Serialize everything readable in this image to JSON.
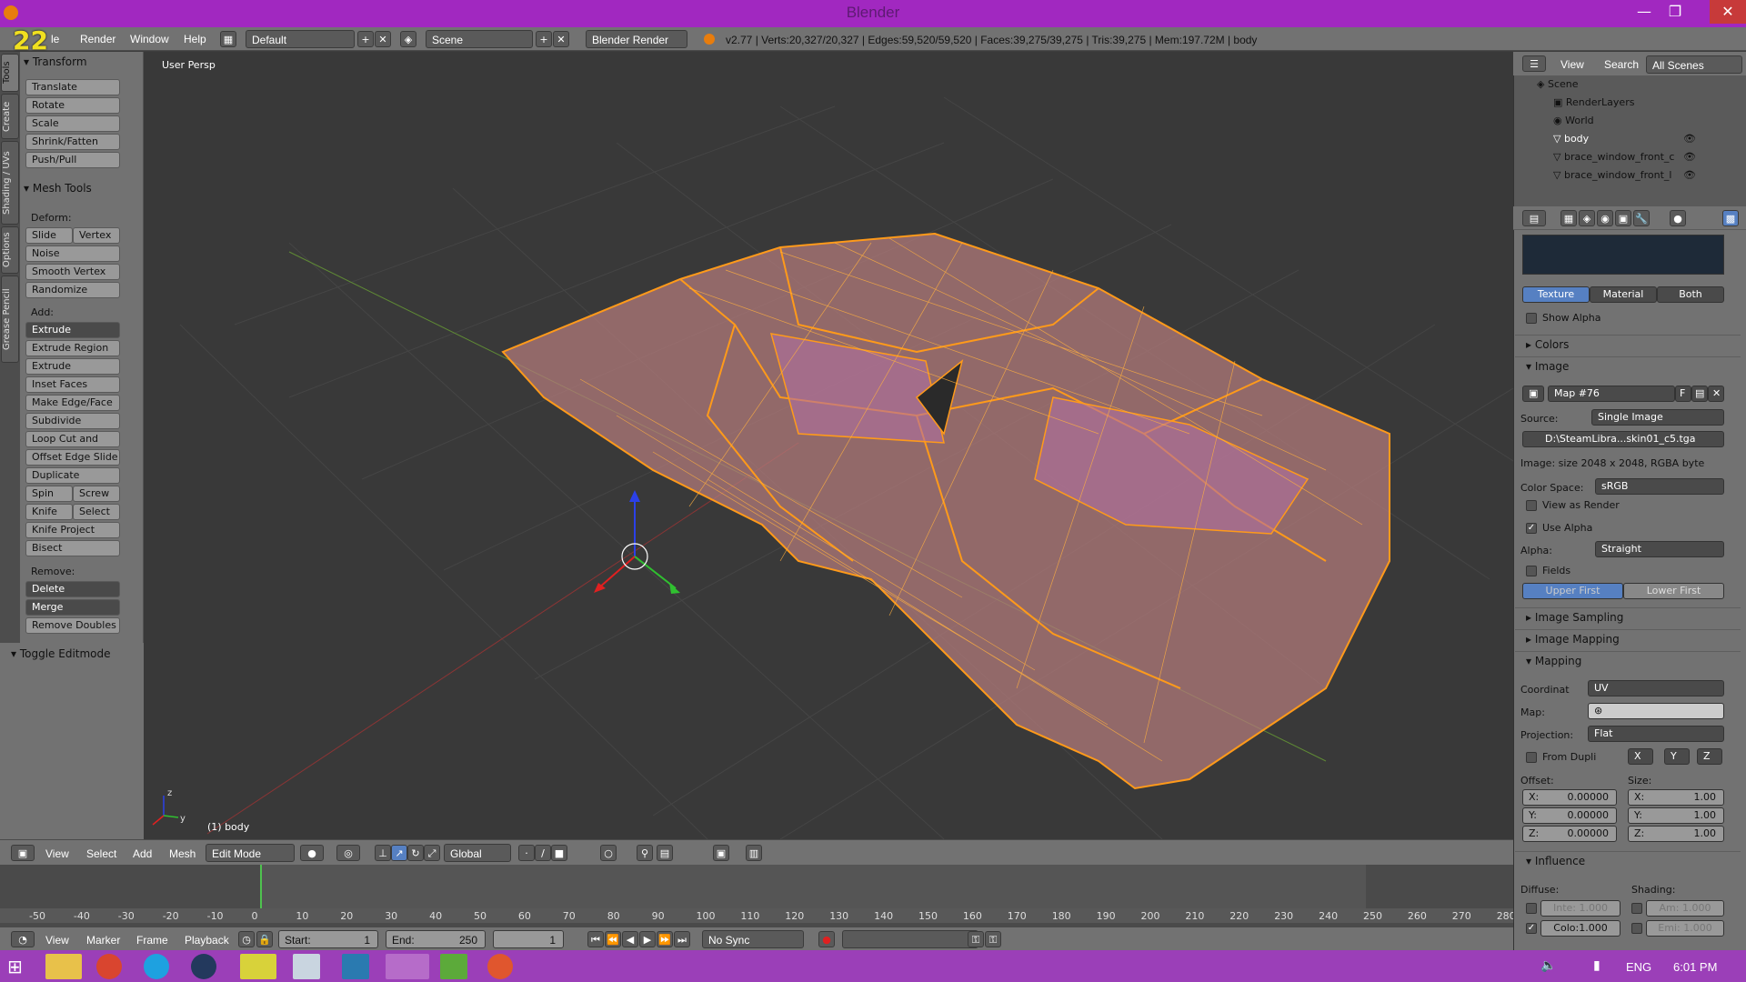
{
  "window": {
    "title": "Blender",
    "minimize": "—",
    "restore": "❐",
    "close": "✕"
  },
  "app_badge": "22",
  "info_header": {
    "menus": [
      "le",
      "Render",
      "Window",
      "Help"
    ],
    "layout": "Default",
    "scene": "Scene",
    "engine": "Blender Render",
    "stats": "v2.77 | Verts:20,327/20,327 | Edges:59,520/59,520 | Faces:39,275/39,275 | Tris:39,275 | Mem:197.72M | body"
  },
  "tool_tabs": [
    "Tools",
    "Create",
    "Shading / UVs",
    "Options",
    "Grease Pencil"
  ],
  "tool_shelf": {
    "transform_header": "Transform",
    "transform": [
      "Translate",
      "Rotate",
      "Scale",
      "Shrink/Fatten",
      "Push/Pull"
    ],
    "mesh_tools_header": "Mesh Tools",
    "deform_label": "Deform:",
    "slide_edge": "Slide Ed",
    "vertex": "Vertex",
    "deform": [
      "Noise",
      "Smooth Vertex",
      "Randomize"
    ],
    "add_label": "Add:",
    "extrude": "Extrude",
    "add": [
      "Extrude Region",
      "Extrude Individual",
      "Inset Faces",
      "Make Edge/Face",
      "Subdivide",
      "Loop Cut and Slide",
      "Offset Edge Slide",
      "Duplicate"
    ],
    "spin": "Spin",
    "screw": "Screw",
    "knife": "Knife",
    "select": "Select",
    "knife_project": "Knife Project",
    "bisect": "Bisect",
    "remove_label": "Remove:",
    "delete": "Delete",
    "merge": "Merge",
    "remove_doubles": "Remove Doubles",
    "toggle_editmode": "Toggle Editmode"
  },
  "viewport": {
    "view_name": "User Persp",
    "object_label": "(1) body",
    "axis_x": "x",
    "axis_y": "y",
    "axis_z": "z"
  },
  "view3d_header": {
    "menus": [
      "View",
      "Select",
      "Add",
      "Mesh"
    ],
    "mode": "Edit Mode",
    "orientation": "Global"
  },
  "timeline": {
    "ticks": [
      "-50",
      "-40",
      "-30",
      "-20",
      "-10",
      "0",
      "10",
      "20",
      "30",
      "40",
      "50",
      "60",
      "70",
      "80",
      "90",
      "100",
      "110",
      "120",
      "130",
      "140",
      "150",
      "160",
      "170",
      "180",
      "190",
      "200",
      "210",
      "220",
      "230",
      "240",
      "250",
      "260",
      "270",
      "280"
    ],
    "menus": [
      "View",
      "Marker",
      "Frame",
      "Playback"
    ],
    "start_label": "Start:",
    "start": "1",
    "end_label": "End:",
    "end": "250",
    "current": "1",
    "sync": "No Sync",
    "current_frame": 0
  },
  "outliner": {
    "menus": [
      "View",
      "Search"
    ],
    "filter": "All Scenes",
    "items": [
      "Scene",
      "RenderLayers",
      "World",
      "body",
      "brace_window_front_c",
      "brace_window_front_l"
    ]
  },
  "properties": {
    "tabs": [
      "Texture",
      "Material",
      "Both"
    ],
    "show_alpha": "Show Alpha",
    "colors": "Colors",
    "image": "Image",
    "map_name": "Map #76",
    "map_f": "F",
    "source_label": "Source:",
    "source": "Single Image",
    "path": "D:\\SteamLibra...skin01_c5.tga",
    "image_info": "Image: size 2048 x 2048, RGBA byte",
    "color_space_label": "Color Space:",
    "color_space": "sRGB",
    "view_as_render": "View as Render",
    "use_alpha": "Use Alpha",
    "alpha_label": "Alpha:",
    "alpha": "Straight",
    "fields": "Fields",
    "upper_first": "Upper First",
    "lower_first": "Lower First",
    "image_sampling": "Image Sampling",
    "image_mapping": "Image Mapping",
    "mapping": "Mapping",
    "coordinate_label": "Coordinat",
    "coordinate": "UV",
    "map_label": "Map:",
    "projection_label": "Projection:",
    "projection": "Flat",
    "from_dupli": "From Dupli",
    "x_btn": "X",
    "y_btn": "Y",
    "z_btn": "Z",
    "offset_label": "Offset:",
    "size_label": "Size:",
    "offset": [
      "X:",
      "0.00000",
      "Y:",
      "0.00000",
      "Z:",
      "0.00000"
    ],
    "size": [
      "X:",
      "1.00",
      "Y:",
      "1.00",
      "Z:",
      "1.00"
    ],
    "influence": "Influence",
    "diffuse_label": "Diffuse:",
    "shading_label": "Shading:",
    "intensity": "Inte: 1.000",
    "color": "Colo:1.000",
    "ambient": "Am: 1.000",
    "emit": "Emi: 1.000"
  },
  "taskbar": {
    "language": "ENG",
    "time": "6:01 PM"
  },
  "colors": {
    "title": "#a128c0",
    "accent": "#5680c2",
    "wire": "#ff9a1a",
    "taskbar": "#9b3fb8"
  }
}
